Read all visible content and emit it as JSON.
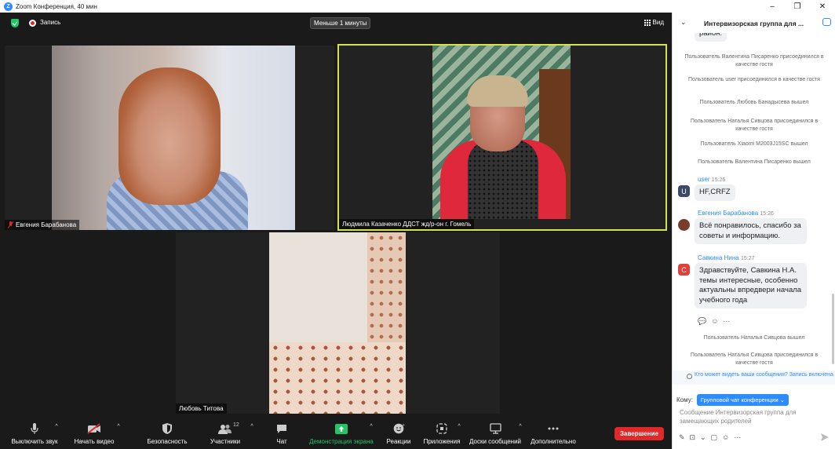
{
  "window": {
    "title": "Zoom Конференция, 40 мин",
    "logo_letter": "Z",
    "controls": [
      "–",
      "❐",
      "✕"
    ]
  },
  "meeting": {
    "recording_label": "Запись",
    "duration_pill": "Меньше 1 минуты",
    "view_label": "Вид",
    "participants": [
      {
        "name": "Евгения Барабанова",
        "muted": true,
        "active_speaker": false
      },
      {
        "name": "Людмила Казаченко ДДСТ жд/р-он г. Гомель",
        "muted": false,
        "active_speaker": true
      },
      {
        "name": "Любовь Титова",
        "muted": false,
        "active_speaker": false
      }
    ]
  },
  "toolbar": {
    "mute": "Выключить звук",
    "video": "Начать видео",
    "security": "Безопасность",
    "participants": "Участники",
    "participants_count": "12",
    "chat": "Чат",
    "share": "Демонстрация экрана",
    "reactions": "Реакции",
    "apps": "Приложения",
    "whiteboards": "Доски сообщений",
    "more": "Дополнительно",
    "end": "Завершение",
    "caret": "^"
  },
  "chat": {
    "title": "Интервизорская группа для ...",
    "partial_top": "район.",
    "system": [
      "Пользователь Валентина Писаренко присоединился в качестве гостя",
      "Пользователь user присоединился в качестве гостя",
      "Пользователь Любовь Банадысева вышел",
      "Пользователь Наталья Сивцова присоединился в качестве гостя",
      "Пользователь Xiaomi M2003J15SC вышел",
      "Пользователь Валентина Писаренко вышел"
    ],
    "messages": [
      {
        "sender": "user",
        "time": "15:26",
        "avatar": "U",
        "avatar_color": "#3b4a66",
        "text": "HF,CRFZ"
      },
      {
        "sender": "Евгения Барабанова",
        "time": "15:26",
        "avatar": "",
        "avatar_color": "#7a3b2a",
        "text": "Всё понравилось, спасибо за советы и информацию."
      },
      {
        "sender": "Савкина Нина",
        "time": "15:27",
        "avatar": "С",
        "avatar_color": "#e0403a",
        "text": "Здравствуйте, Савкина Н.А. темы интересные, особенно актуальны впредвери начала учебного года"
      }
    ],
    "reaction_icons": [
      "💬",
      "☺",
      "···"
    ],
    "system_after": [
      "Пользователь Наталья Сивцова вышел",
      "Пользователь Наталья Сивцова присоединился в качестве гостя"
    ],
    "notice": "Кто может видеть ваши сообщения? Запись включена",
    "to_label": "Кому:",
    "to_value": "Групповой чат конференции ⌄",
    "compose_placeholder": "Сообщение Интервизорская группа для замещающих родителей",
    "compose_tools": [
      "✎",
      "⊡",
      "⌄",
      "▢",
      "☺",
      "···"
    ]
  }
}
